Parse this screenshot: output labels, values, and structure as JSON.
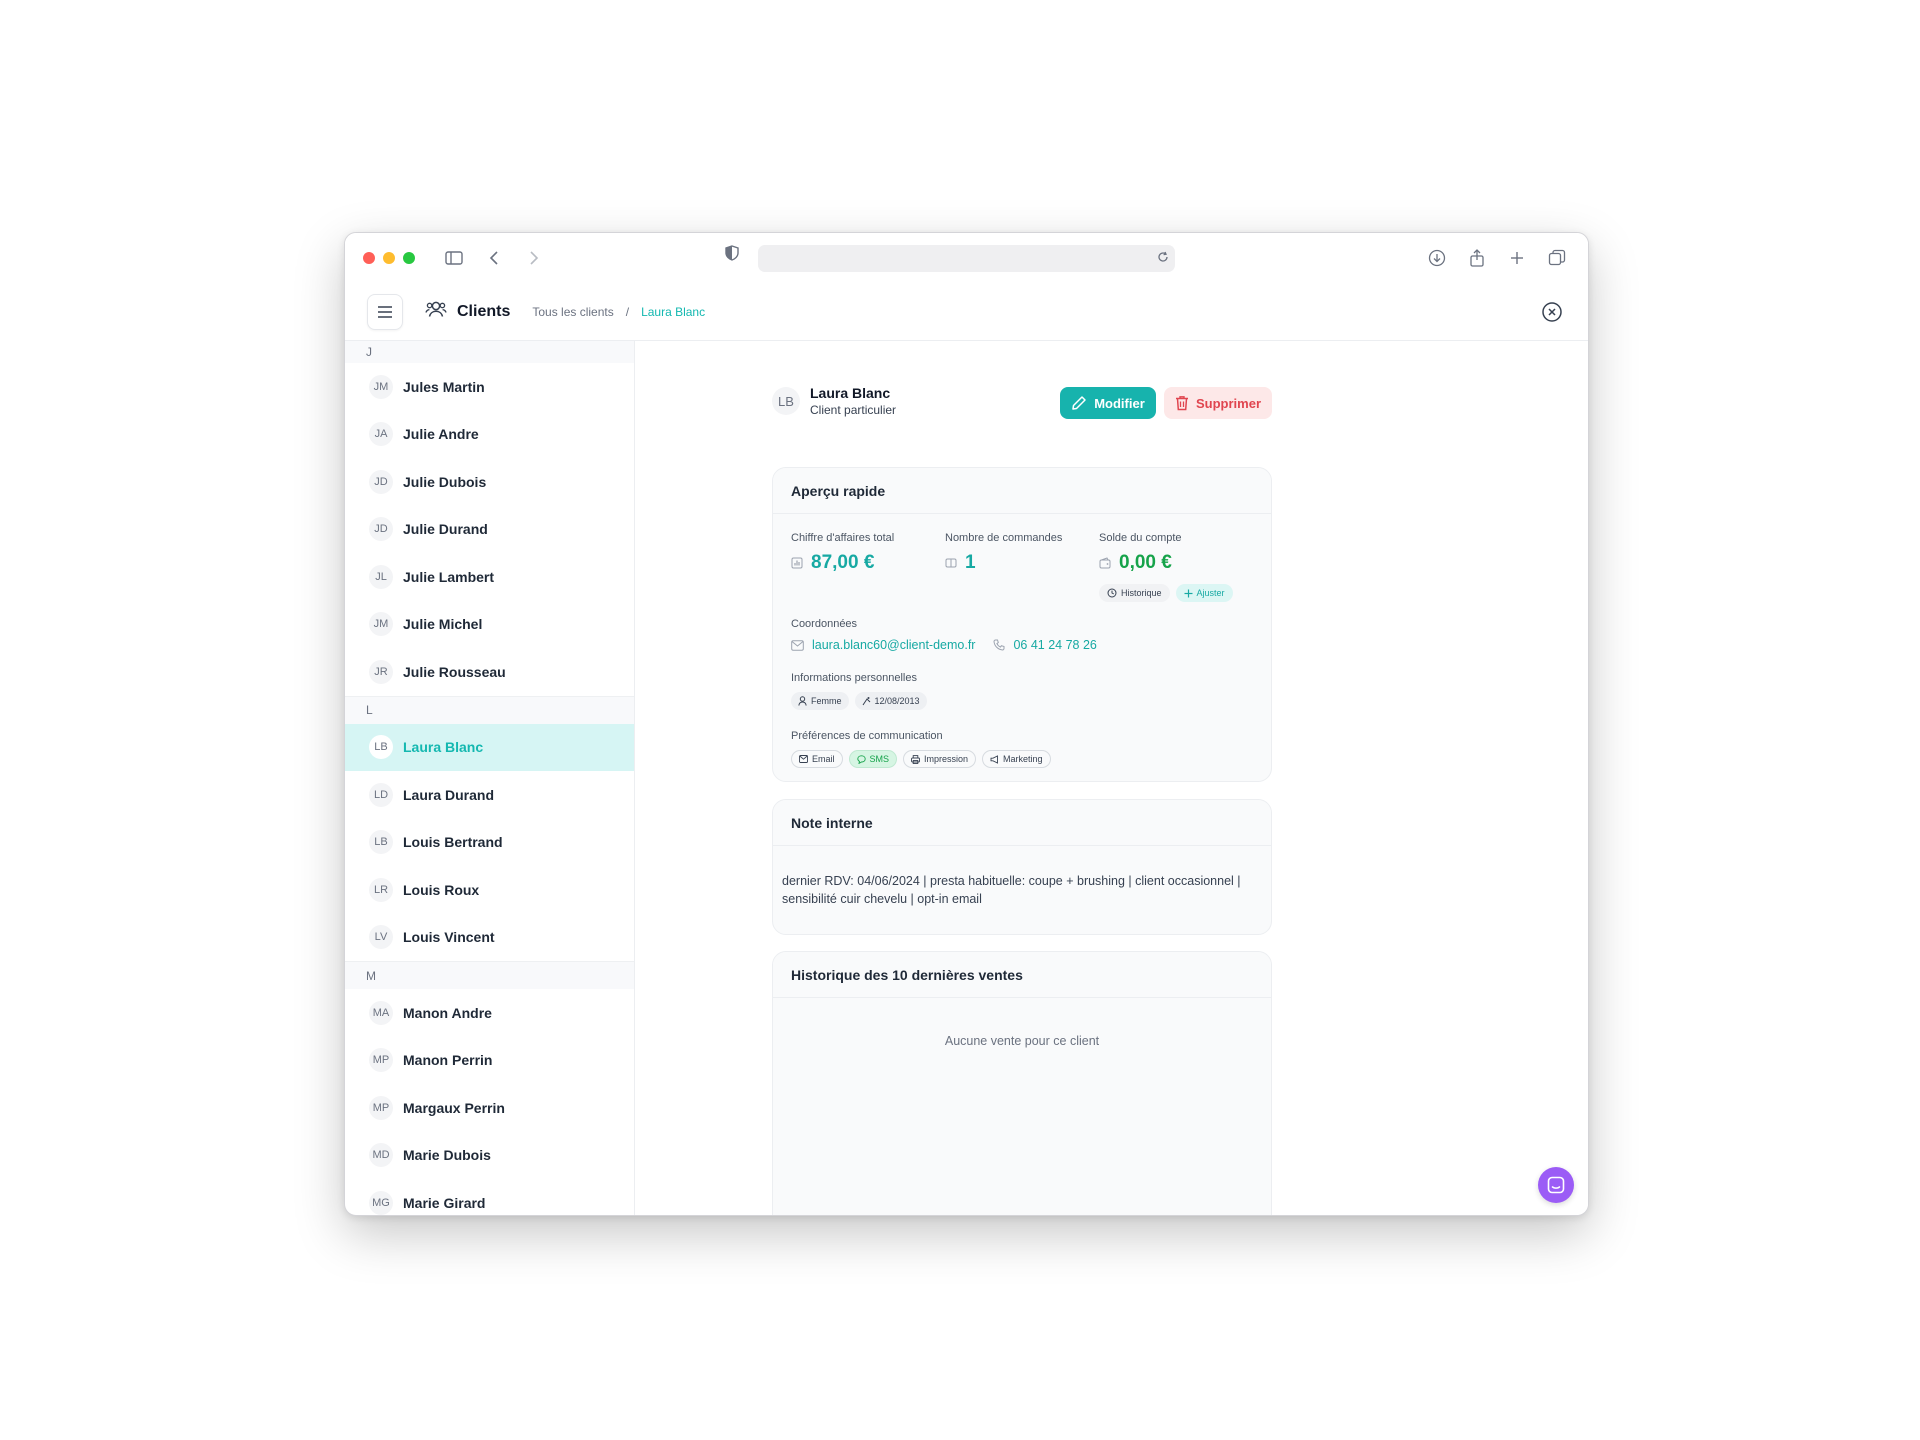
{
  "app": {
    "title": "Clients"
  },
  "breadcrumb": {
    "root": "Tous les clients",
    "separator": "/",
    "current": "Laura Blanc"
  },
  "sidebar": {
    "groups": [
      {
        "letter": "J",
        "clients": [
          {
            "initials": "JM",
            "name": "Jules Martin"
          },
          {
            "initials": "JA",
            "name": "Julie Andre"
          },
          {
            "initials": "JD",
            "name": "Julie Dubois"
          },
          {
            "initials": "JD",
            "name": "Julie Durand"
          },
          {
            "initials": "JL",
            "name": "Julie Lambert"
          },
          {
            "initials": "JM",
            "name": "Julie Michel"
          },
          {
            "initials": "JR",
            "name": "Julie Rousseau"
          }
        ]
      },
      {
        "letter": "L",
        "clients": [
          {
            "initials": "LB",
            "name": "Laura Blanc"
          },
          {
            "initials": "LD",
            "name": "Laura Durand"
          },
          {
            "initials": "LB",
            "name": "Louis Bertrand"
          },
          {
            "initials": "LR",
            "name": "Louis Roux"
          },
          {
            "initials": "LV",
            "name": "Louis Vincent"
          }
        ]
      },
      {
        "letter": "M",
        "clients": [
          {
            "initials": "MA",
            "name": "Manon Andre"
          },
          {
            "initials": "MP",
            "name": "Manon Perrin"
          },
          {
            "initials": "MP",
            "name": "Margaux Perrin"
          },
          {
            "initials": "MD",
            "name": "Marie Dubois"
          },
          {
            "initials": "MG",
            "name": "Marie Girard"
          }
        ]
      }
    ],
    "active": "Laura Blanc"
  },
  "profile": {
    "initials": "LB",
    "name": "Laura Blanc",
    "type": "Client particulier",
    "edit_label": "Modifier",
    "delete_label": "Supprimer"
  },
  "overview": {
    "title": "Aperçu rapide",
    "revenue_label": "Chiffre d'affaires total",
    "revenue_value": "87,00 €",
    "orders_label": "Nombre de commandes",
    "orders_value": "1",
    "balance_label": "Solde du compte",
    "balance_value": "0,00 €",
    "history_label": "Historique",
    "adjust_label": "Ajuster",
    "contact_label": "Coordonnées",
    "email": "laura.blanc60@client-demo.fr",
    "phone": "06 41 24 78 26",
    "personal_label": "Informations personnelles",
    "gender": "Femme",
    "birthdate": "12/08/2013",
    "comm_label": "Préférences de communication",
    "comm_email": "Email",
    "comm_sms": "SMS",
    "comm_print": "Impression",
    "comm_marketing": "Marketing"
  },
  "note": {
    "title": "Note interne",
    "line1": "dernier RDV: 04/06/2024 | presta habituelle: coupe + brushing | client occasionnel |",
    "line2": "sensibilité cuir chevelu | opt-in email"
  },
  "sales": {
    "title": "Historique des 10 dernières ventes",
    "empty": "Aucune vente pour ce client"
  },
  "colors": {
    "accent": "#17b3ad",
    "danger": "#e0454f",
    "success": "#16a34a",
    "fab": "#9b5cf6"
  }
}
